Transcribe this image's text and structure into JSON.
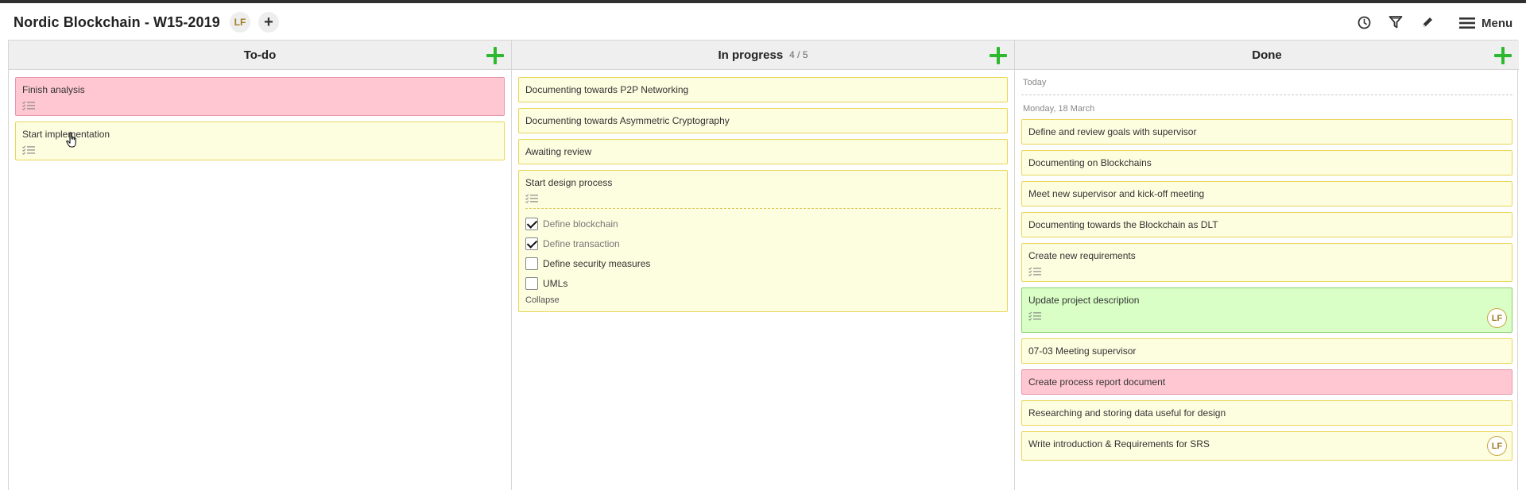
{
  "header": {
    "title": "Nordic Blockchain - W15-2019",
    "member_initials": "LF",
    "add_member_symbol": "+",
    "menu_label": "Menu",
    "icons": [
      "clock-icon",
      "filter-icon",
      "pencil-icon",
      "hamburger-icon"
    ]
  },
  "columns": {
    "todo": {
      "title": "To-do",
      "cards": [
        {
          "title": "Finish analysis",
          "color": "#ffc7d2"
        },
        {
          "title": "Start implementation",
          "color": "#fdfde0"
        }
      ]
    },
    "inprogress": {
      "title": "In progress",
      "count": "4 / 5",
      "cards": [
        {
          "title": "Documenting towards P2P Networking"
        },
        {
          "title": "Documenting towards Asymmetric Cryptography"
        },
        {
          "title": "Awaiting review"
        },
        {
          "title": "Start design process",
          "checklist": [
            {
              "label": "Define blockchain",
              "checked": true
            },
            {
              "label": "Define transaction",
              "checked": true
            },
            {
              "label": "Define security measures",
              "checked": false
            },
            {
              "label": "UMLs",
              "checked": false
            }
          ],
          "collapse_label": "Collapse"
        }
      ]
    },
    "done": {
      "title": "Done",
      "group_today": "Today",
      "group_date": "Monday, 18 March",
      "cards": [
        {
          "title": "Define and review goals with supervisor"
        },
        {
          "title": "Documenting on Blockchains"
        },
        {
          "title": "Meet new supervisor and kick-off meeting"
        },
        {
          "title": "Documenting towards the Blockchain as DLT"
        },
        {
          "title": "Create new requirements"
        },
        {
          "title": "Update project description",
          "color": "#d9ffc6",
          "assignee": "LF"
        },
        {
          "title": "07-03 Meeting supervisor"
        },
        {
          "title": "Create process report document",
          "color": "#ffc7d2"
        },
        {
          "title": "Researching and storing data useful for design"
        },
        {
          "title": "Write introduction & Requirements for SRS",
          "assignee": "LF"
        }
      ]
    }
  },
  "colors": {
    "accent_add": "#2eb82e",
    "card_yellow": "#fdfde0",
    "card_red": "#ffc7d2",
    "card_green": "#d9ffc6",
    "column_header_bg": "#efefef"
  }
}
